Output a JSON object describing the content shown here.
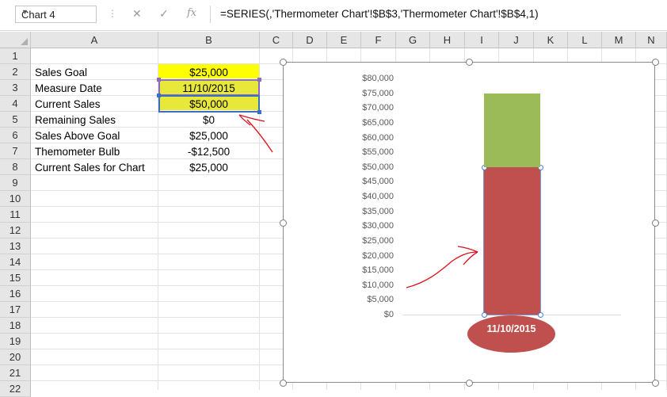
{
  "formula_bar": {
    "name_box": "Chart 4",
    "cancel_icon": "close-icon",
    "enter_icon": "checkmark-icon",
    "function_icon": "fx",
    "formula": "=SERIES(,'Thermometer Chart'!$B$3,'Thermometer Chart'!$B$4,1)"
  },
  "sheet": {
    "columns": [
      "A",
      "B",
      "C",
      "D",
      "E",
      "F",
      "G",
      "H",
      "I",
      "J",
      "K",
      "L",
      "M",
      "N"
    ],
    "rows": [
      "1",
      "2",
      "3",
      "4",
      "5",
      "6",
      "7",
      "8",
      "9",
      "10",
      "11",
      "12",
      "13",
      "14",
      "15",
      "16",
      "17",
      "18",
      "19",
      "20",
      "21",
      "22"
    ],
    "labels": {
      "r2": "Sales Goal",
      "r3": "Measure Date",
      "r4": "Current Sales",
      "r5": "Remaining Sales",
      "r6": "Sales Above Goal",
      "r7": "Themometer Bulb",
      "r8": "Current Sales for Chart"
    },
    "values": {
      "r2": "$25,000",
      "r3": "11/10/2015",
      "r4": "$50,000",
      "r5": "$0",
      "r6": "$25,000",
      "r7": "-$12,500",
      "r8": "$25,000"
    },
    "highlight_color": "#ffff00"
  },
  "chart_data": {
    "type": "bar",
    "stacked": true,
    "categories": [
      "11/10/2015"
    ],
    "series": [
      {
        "values": [
          50000
        ],
        "color": "#c0504d"
      },
      {
        "values": [
          25000
        ],
        "color": "#9bbb59"
      }
    ],
    "y_ticks": [
      "$80,000",
      "$75,000",
      "$70,000",
      "$65,000",
      "$60,000",
      "$55,000",
      "$50,000",
      "$45,000",
      "$40,000",
      "$35,000",
      "$30,000",
      "$25,000",
      "$20,000",
      "$15,000",
      "$10,000",
      "$5,000",
      "$0"
    ],
    "ylim": [
      0,
      80000
    ],
    "bulb_label": "11/10/2015",
    "legend": "none"
  }
}
